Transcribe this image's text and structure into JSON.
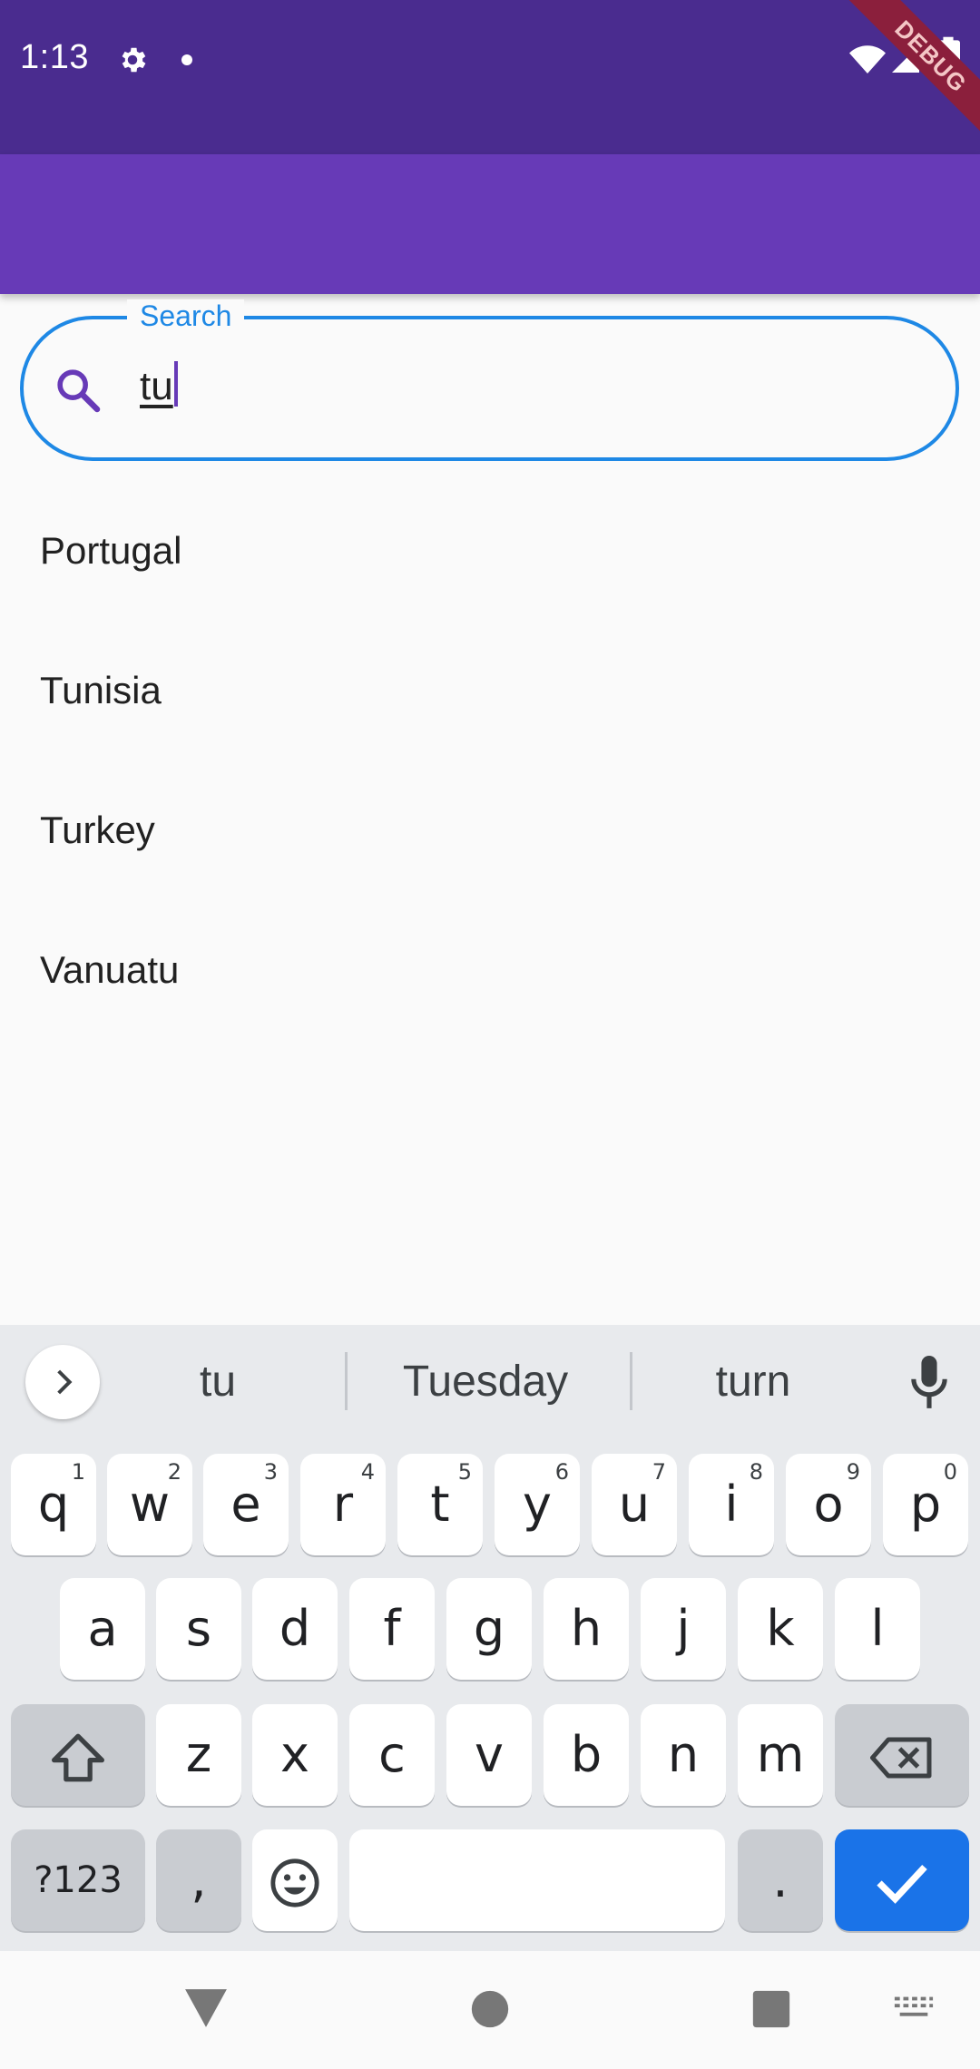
{
  "status_bar": {
    "time": "1:13",
    "debug_label": "DEBUG"
  },
  "search": {
    "label": "Search",
    "value": "tu"
  },
  "results": [
    "Portugal",
    "Tunisia",
    "Turkey",
    "Vanuatu"
  ],
  "keyboard": {
    "suggestions": [
      "tu",
      "Tuesday",
      "turn"
    ],
    "row1": [
      {
        "key": "q",
        "hint": "1"
      },
      {
        "key": "w",
        "hint": "2"
      },
      {
        "key": "e",
        "hint": "3"
      },
      {
        "key": "r",
        "hint": "4"
      },
      {
        "key": "t",
        "hint": "5"
      },
      {
        "key": "y",
        "hint": "6"
      },
      {
        "key": "u",
        "hint": "7"
      },
      {
        "key": "i",
        "hint": "8"
      },
      {
        "key": "o",
        "hint": "9"
      },
      {
        "key": "p",
        "hint": "0"
      }
    ],
    "row2": [
      "a",
      "s",
      "d",
      "f",
      "g",
      "h",
      "j",
      "k",
      "l"
    ],
    "row3": [
      "z",
      "x",
      "c",
      "v",
      "b",
      "n",
      "m"
    ],
    "symbols_label": "?123",
    "comma_label": ",",
    "period_label": "."
  },
  "colors": {
    "status_bar": "#4a2c8f",
    "app_bar": "#673ab7",
    "focus_blue": "#1e88e5",
    "enter_key": "#1a73e8"
  }
}
